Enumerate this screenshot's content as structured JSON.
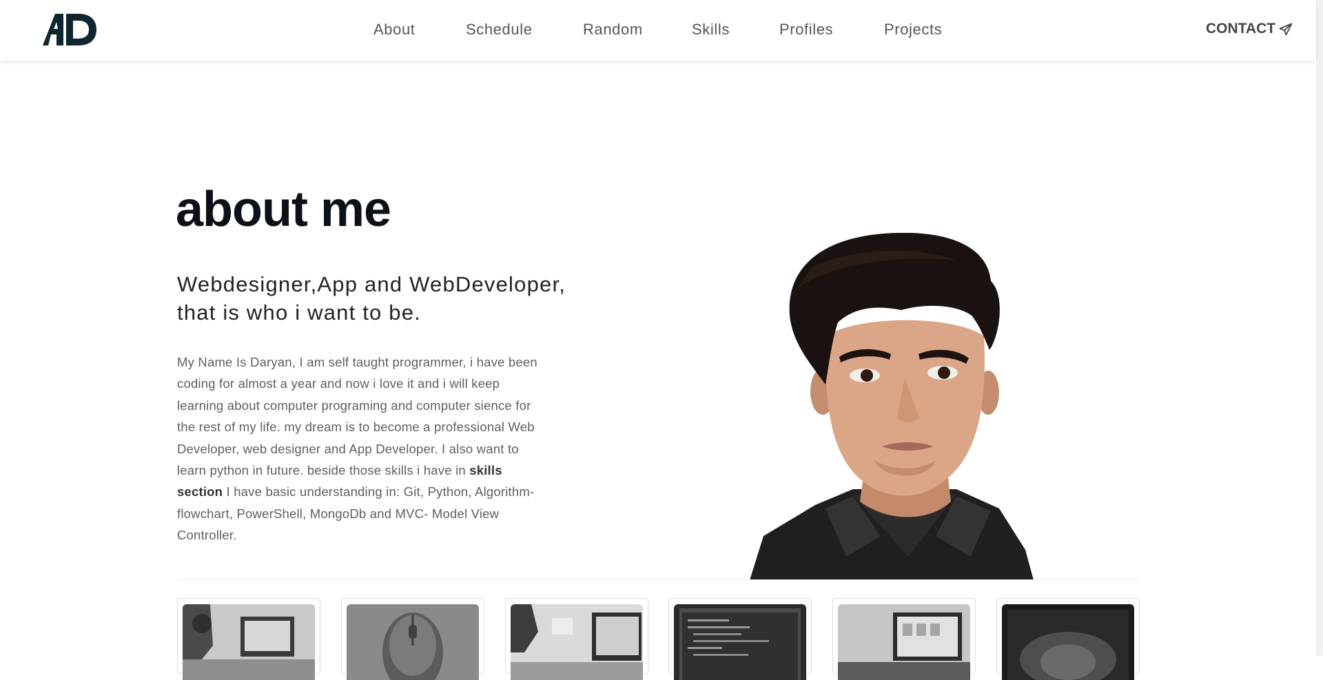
{
  "nav": {
    "logo_text": "AD",
    "links": [
      "About",
      "Schedule",
      "Random",
      "Skills",
      "Profiles",
      "Projects"
    ],
    "contact_label": "CONTACT",
    "contact_icon": "paper-plane-icon"
  },
  "hero": {
    "title": "about me",
    "tagline_line1": "Webdesigner,App and WebDeveloper,",
    "tagline_line2": "that is who i want to be.",
    "bio_part1": "My Name Is Daryan, I am self taught programmer, i have been coding for almost a year and now i love it and i will keep learning about computer programing and computer sience for the rest of my life. my dream is to become a professional Web Developer, web designer and App Developer. I also want to learn python in future. beside those skills i have in ",
    "bio_bold": "skills section",
    "bio_part2": " I have basic understanding in: Git, Python, Algorithm-flowchart, PowerShell, MongoDb and MVC- Model View Controller."
  },
  "gallery": {
    "items": [
      {
        "icon": "photo-workspace"
      },
      {
        "icon": "photo-mouse"
      },
      {
        "icon": "photo-desk"
      },
      {
        "icon": "photo-code-screen"
      },
      {
        "icon": "photo-monitor"
      },
      {
        "icon": "photo-dark-screen"
      }
    ]
  },
  "colors": {
    "heading": "#0c1018",
    "body_text": "#5f5f5f",
    "nav_text": "#555555",
    "logo": "#0f2530"
  }
}
